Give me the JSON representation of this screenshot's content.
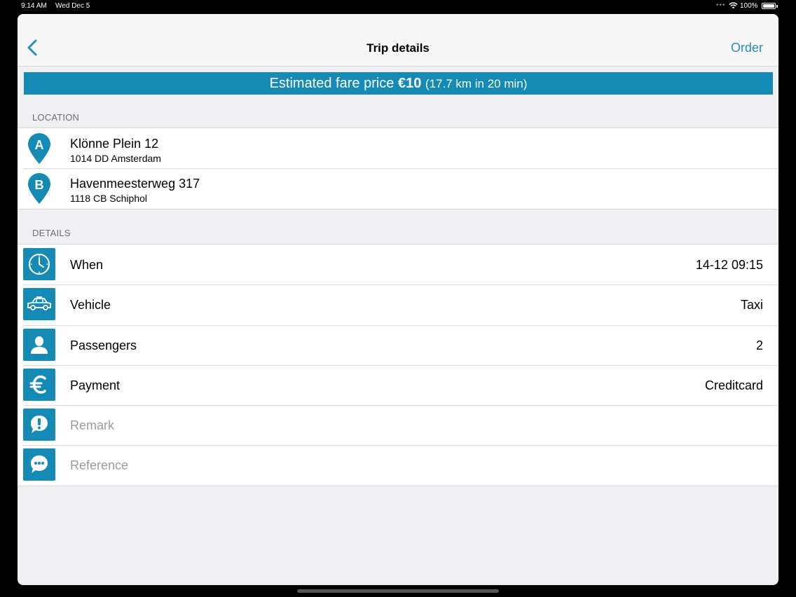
{
  "status_bar": {
    "time": "9:14 AM",
    "date": "Wed Dec 5",
    "battery": "100%"
  },
  "navbar": {
    "title": "Trip details",
    "back_icon": "chevron-left-icon",
    "order_label": "Order"
  },
  "fare": {
    "prefix": "Estimated fare price",
    "amount": "€10",
    "detail": "(17.7 km in 20 min)"
  },
  "location": {
    "header": "LOCATION",
    "items": [
      {
        "marker": "A",
        "title": "Klönne Plein 12",
        "subtitle": "1014 DD Amsterdam"
      },
      {
        "marker": "B",
        "title": "Havenmeesterweg 317",
        "subtitle": "1118 CB Schiphol"
      }
    ]
  },
  "details": {
    "header": "DETAILS",
    "items": [
      {
        "icon": "clock-icon",
        "label": "When",
        "value": "14-12 09:15"
      },
      {
        "icon": "car-icon",
        "label": "Vehicle",
        "value": "Taxi"
      },
      {
        "icon": "person-icon",
        "label": "Passengers",
        "value": "2"
      },
      {
        "icon": "euro-icon",
        "label": "Payment",
        "value": "Creditcard"
      },
      {
        "icon": "exclamation-bubble-icon",
        "label": "Remark",
        "value": ""
      },
      {
        "icon": "chat-bubble-icon",
        "label": "Reference",
        "value": ""
      }
    ]
  },
  "colors": {
    "accent": "#158ab4",
    "link": "#2a8db8",
    "background": "#efeff4"
  }
}
